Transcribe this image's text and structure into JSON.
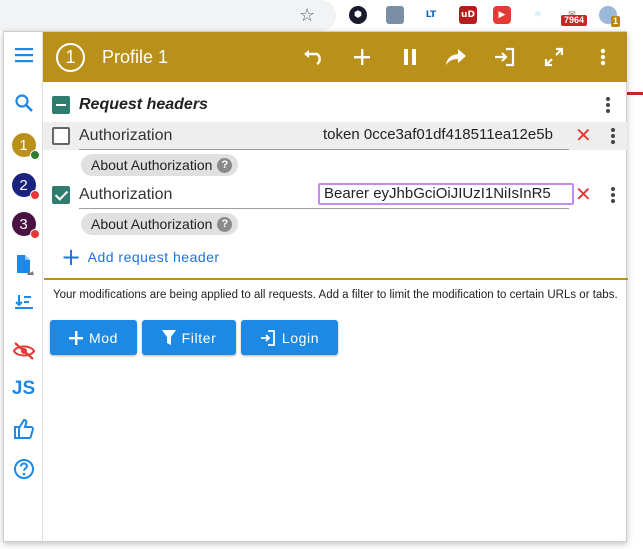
{
  "browser": {
    "extensions": [
      {
        "icon": "hexagon-extension-icon",
        "color": "#1a1a2e"
      },
      {
        "icon": "person-extension-icon",
        "color": "#7a8fa6"
      },
      {
        "icon": "lt-extension-icon",
        "label": "LT",
        "color": "#ffffff"
      },
      {
        "icon": "ublock-icon",
        "label": "uD",
        "color": "#b71c1c"
      },
      {
        "icon": "youtube-icon",
        "color": "#e53935"
      },
      {
        "icon": "react-icon",
        "color": "#9bd8f0"
      },
      {
        "icon": "mail-extension-icon",
        "badge": "7964"
      },
      {
        "icon": "modheader-extension-icon",
        "badge": "1"
      }
    ]
  },
  "header": {
    "profile_number": "1",
    "profile_name": "Profile 1",
    "color": "#b8901a"
  },
  "rail": {
    "profiles": [
      {
        "number": "1",
        "color": "#b8901a",
        "status_color": "#2e7d32"
      },
      {
        "number": "2",
        "color": "#1a237e",
        "status_color": "#e53935"
      },
      {
        "number": "3",
        "color": "#4a1240",
        "status_color": "#e53935"
      }
    ]
  },
  "request_headers": {
    "title": "Request headers",
    "rows": [
      {
        "enabled": false,
        "name": "Authorization",
        "value": "token 0cce3af01df418511ea12e5b",
        "about": "About Authorization"
      },
      {
        "enabled": true,
        "name": "Authorization",
        "value": "Bearer eyJhbGciOiJIUzI1NiIsInR5",
        "about": "About Authorization"
      }
    ],
    "add_label": "Add request header"
  },
  "info": "Your modifications are being applied to all requests. Add a filter to limit the modification to certain URLs or tabs.",
  "actions": {
    "mod": "Mod",
    "filter": "Filter",
    "login": "Login"
  },
  "colors": {
    "accent": "#1e88e5",
    "checkbox": "#2f7d6f",
    "delete": "#e53935"
  }
}
